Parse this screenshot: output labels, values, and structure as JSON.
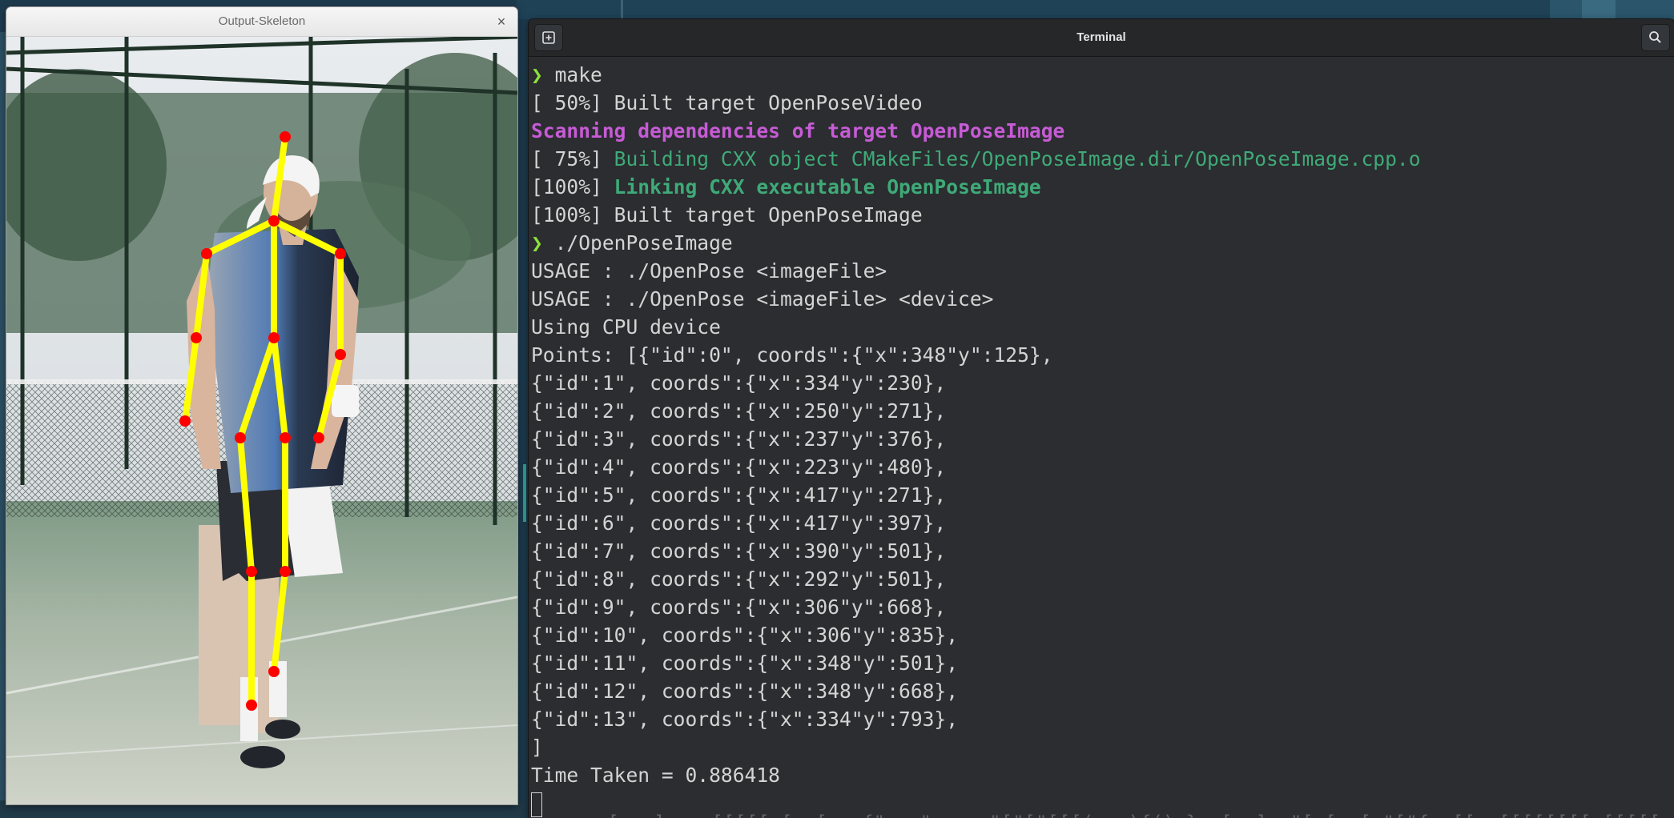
{
  "viewer": {
    "title": "Output-Skeleton",
    "close_symbol": "×"
  },
  "terminal": {
    "title": "Terminal",
    "lines": [
      {
        "prompt": "❯ ",
        "cmd": "make"
      },
      {
        "plain": "[ 50%] Built target OpenPoseVideo"
      },
      {
        "magenta": "Scanning dependencies of target OpenPoseImage"
      },
      {
        "prefix": "[ 75%] ",
        "green": "Building CXX object CMakeFiles/OpenPoseImage.dir/OpenPoseImage.cpp.o"
      },
      {
        "prefix": "[100%] ",
        "green_bold": "Linking CXX executable OpenPoseImage"
      },
      {
        "plain": "[100%] Built target OpenPoseImage"
      },
      {
        "prompt": "❯ ",
        "cmd": "./OpenPoseImage"
      },
      {
        "plain": "USAGE : ./OpenPose <imageFile>"
      },
      {
        "plain": "USAGE : ./OpenPose <imageFile> <device>"
      },
      {
        "plain": "Using CPU device"
      },
      {
        "plain": "Points: [{\"id\":0\", coords\":{\"x\":348\"y\":125},"
      },
      {
        "plain": "{\"id\":1\", coords\":{\"x\":334\"y\":230},"
      },
      {
        "plain": "{\"id\":2\", coords\":{\"x\":250\"y\":271},"
      },
      {
        "plain": "{\"id\":3\", coords\":{\"x\":237\"y\":376},"
      },
      {
        "plain": "{\"id\":4\", coords\":{\"x\":223\"y\":480},"
      },
      {
        "plain": "{\"id\":5\", coords\":{\"x\":417\"y\":271},"
      },
      {
        "plain": "{\"id\":6\", coords\":{\"x\":417\"y\":397},"
      },
      {
        "plain": "{\"id\":7\", coords\":{\"x\":390\"y\":501},"
      },
      {
        "plain": "{\"id\":8\", coords\":{\"x\":292\"y\":501},"
      },
      {
        "plain": "{\"id\":9\", coords\":{\"x\":306\"y\":668},"
      },
      {
        "plain": "{\"id\":10\", coords\":{\"x\":306\"y\":835},"
      },
      {
        "plain": "{\"id\":11\", coords\":{\"x\":348\"y\":501},"
      },
      {
        "plain": "{\"id\":12\", coords\":{\"x\":348\"y\":668},"
      },
      {
        "plain": "{\"id\":13\", coords\":{\"x\":334\"y\":793},"
      },
      {
        "plain": "]"
      },
      {
        "plain": "Time Taken = 0.886418"
      },
      {
        "cursor": true
      }
    ],
    "ghost": "  +[...] ...[[[[[-[..[.. {\"x--\"y  ..\"[\"[\"[[[(...){()-}..[..]..\"[.[..[-\"[\"{..[[  [[[[[[[[ [[[[[[[[[["
  },
  "colors": {
    "prompt_arrow": "#8ee03a",
    "magenta": "#c75bd6",
    "green": "#3faa78",
    "skeleton_line": "#ffff00",
    "keypoint": "#ff0000"
  }
}
